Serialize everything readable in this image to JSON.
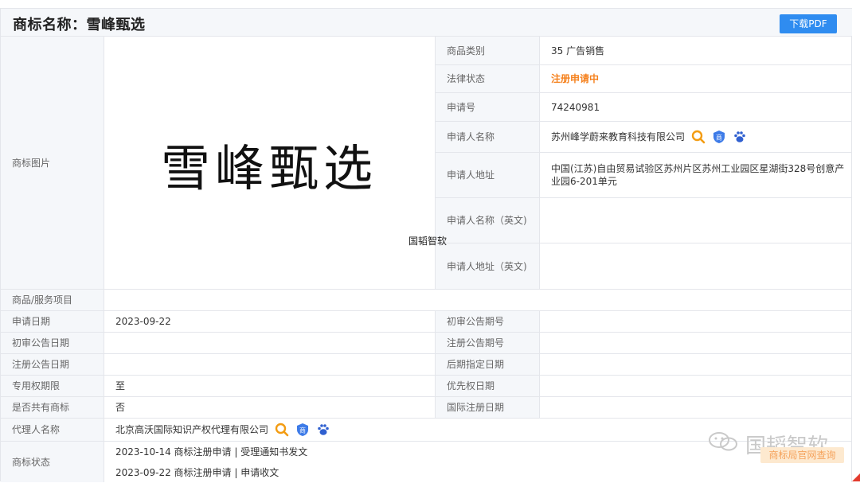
{
  "header": {
    "title": "商标名称：雪峰甄选",
    "pdf_button": "下载PDF"
  },
  "image": {
    "label": "商标图片",
    "mark_text": "雪峰甄选"
  },
  "info": {
    "category_label": "商品类别",
    "category_value": "35 广告销售",
    "legal_label": "法律状态",
    "legal_value": "注册申请中",
    "appno_label": "申请号",
    "appno_value": "74240981",
    "applicant_label": "申请人名称",
    "applicant_value": "苏州峰学蔚来教育科技有限公司",
    "address_label": "申请人地址",
    "address_value": "中国(江苏)自由贸易试验区苏州片区苏州工业园区星湖街328号创意产业园6-201单元",
    "applicant_en_label": "申请人名称（英文)",
    "applicant_en_value": "",
    "address_en_label": "申请人地址（英文)",
    "address_en_value": ""
  },
  "rows": {
    "goods_label": "商品/服务项目",
    "goods_value": "",
    "date_label": "申请日期",
    "date_value": "2023-09-22",
    "prelim_no_label": "初审公告期号",
    "prelim_no_value": "",
    "prelim_date_label": "初审公告日期",
    "prelim_date_value": "",
    "reg_no_label": "注册公告期号",
    "reg_no_value": "",
    "reg_date_label": "注册公告日期",
    "reg_date_value": "",
    "later_label": "后期指定日期",
    "later_value": "",
    "excl_label": "专用权期限",
    "excl_value": "至",
    "priority_label": "优先权日期",
    "priority_value": "",
    "shared_label": "是否共有商标",
    "shared_value": "否",
    "intl_label": "国际注册日期",
    "intl_value": "",
    "agent_label": "代理人名称",
    "agent_value": "北京高沃国际知识产权代理有限公司",
    "status_label": "商标状态",
    "status_items": [
      "2023-10-14 商标注册申请 | 受理通知书发文",
      "2023-09-22 商标注册申请 | 申请收文"
    ]
  },
  "watermarks": {
    "small": "国韬智软",
    "big": "国韬智软",
    "query": "商标局官网查询"
  },
  "colors": {
    "accent": "#2f8cf0",
    "status": "#f5821f",
    "search_icon": "#f39c12",
    "shield_icon": "#3d7be8",
    "paw_icon": "#3060d0"
  },
  "icons": [
    "search-icon",
    "shield-icon",
    "paw-icon",
    "wechat-icon"
  ]
}
